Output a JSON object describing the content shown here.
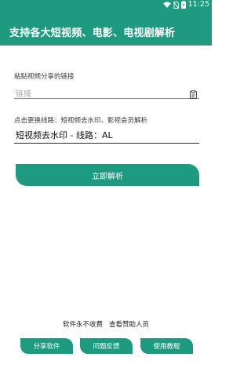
{
  "status_bar": {
    "time": "11:25",
    "icons": [
      "wifi-icon",
      "no-sim-icon",
      "battery-charging-icon"
    ]
  },
  "app_bar": {
    "title": "支持各大短视频、电影、电视剧解析"
  },
  "link_section": {
    "label": "粘贴视频分享的链接",
    "input_placeholder": "链接",
    "input_value": "",
    "paste_icon": "clipboard-paste-icon"
  },
  "route_section": {
    "label": "点击更换线路：短视频去水印、影视会员解析",
    "selected_route": "短视频去水印 - 线路：AL"
  },
  "parse_button": {
    "label": "立即解析"
  },
  "footer": {
    "free_text": "软件永不收费",
    "sponsors_link": "查看赞助人员"
  },
  "bottom_buttons": {
    "share": "分享软件",
    "feedback": "问题反馈",
    "tutorial": "使用教程"
  },
  "colors": {
    "primary": "#1d9a7f",
    "text": "#222222",
    "placeholder": "#a7a7a7"
  }
}
